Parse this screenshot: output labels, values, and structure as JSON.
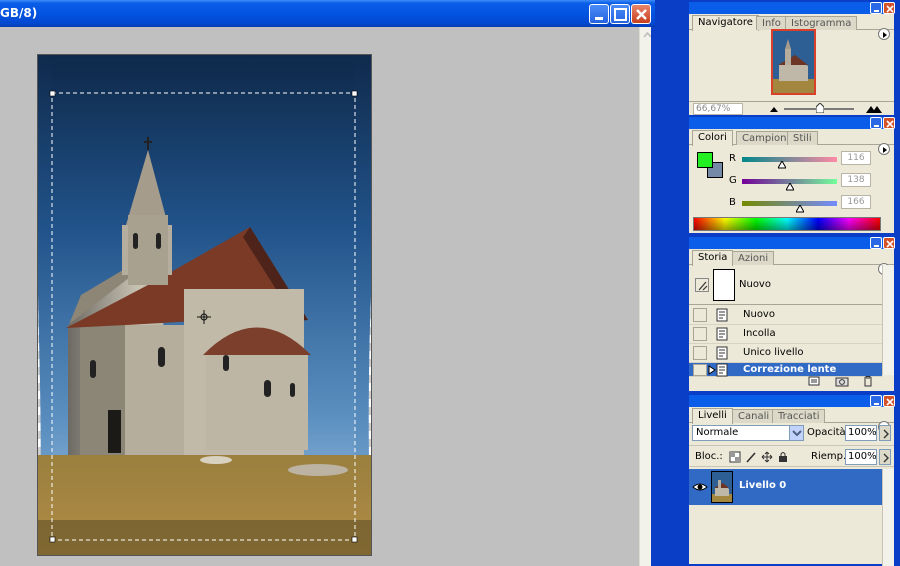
{
  "document": {
    "title": "GB/8)",
    "minimize_icon": "minimize-icon",
    "maximize_icon": "maximize-icon",
    "close_icon": "close-icon"
  },
  "colors": {
    "titlebar": "#0354e2",
    "canvas_bg": "#c0c0c0",
    "panel_bg": "#ece9d8",
    "selection": "#316ac5",
    "foreground_color": "#22ee22",
    "background_color": "#748aa6"
  },
  "navigator": {
    "tabs": [
      "Navigatore",
      "Info",
      "Istogramma"
    ],
    "zoom": "66,67%"
  },
  "color_panel": {
    "tabs": [
      "Colori",
      "Campioni",
      "Stili"
    ],
    "channels": [
      {
        "label": "R",
        "value": "116"
      },
      {
        "label": "G",
        "value": "138"
      },
      {
        "label": "B",
        "value": "166"
      }
    ]
  },
  "history": {
    "tabs": [
      "Storia",
      "Azioni"
    ],
    "snapshot_label": "Nuovo",
    "items": [
      {
        "label": "Nuovo",
        "selected": false
      },
      {
        "label": "Incolla",
        "selected": false
      },
      {
        "label": "Unico livello",
        "selected": false
      },
      {
        "label": "Correzione lente",
        "selected": true
      }
    ]
  },
  "layers": {
    "tabs": [
      "Livelli",
      "Canali",
      "Tracciati"
    ],
    "blend_mode": "Normale",
    "opacity_label": "Opacità:",
    "opacity": "100%",
    "lock_label": "Bloc.:",
    "fill_label": "Riemp.:",
    "fill": "100%",
    "layer_name": "Livello 0"
  }
}
